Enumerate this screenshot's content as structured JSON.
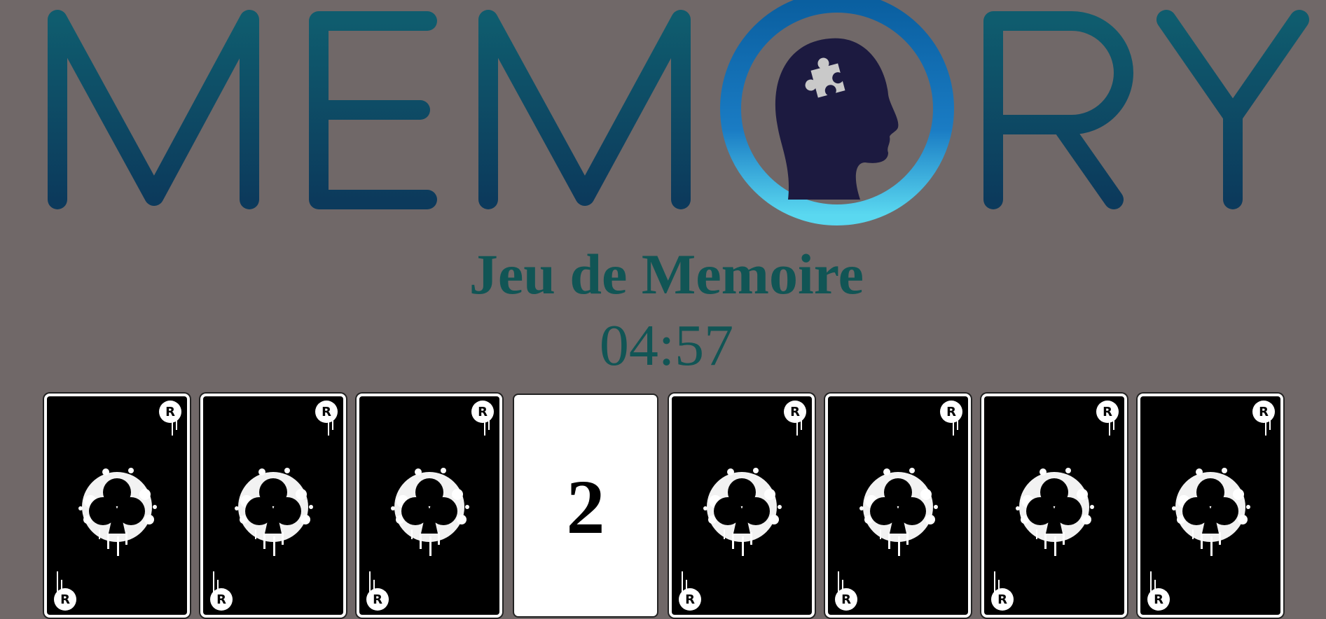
{
  "logo": {
    "text": "MEMORY",
    "colors": {
      "letters": "#0e4f66",
      "ring": "#1275b8",
      "head": "#1c1a40",
      "puzzle": "#c7c7c7"
    },
    "icon": "brain-puzzle-head-icon"
  },
  "game": {
    "title": "Jeu de Memoire",
    "timer": "04:57"
  },
  "cards": [
    {
      "state": "back",
      "icon": "club-splash-icon"
    },
    {
      "state": "back",
      "icon": "club-splash-icon"
    },
    {
      "state": "back",
      "icon": "club-splash-icon"
    },
    {
      "state": "revealed",
      "value": "2"
    },
    {
      "state": "back",
      "icon": "club-splash-icon"
    },
    {
      "state": "back",
      "icon": "club-splash-icon"
    },
    {
      "state": "back",
      "icon": "club-splash-icon"
    },
    {
      "state": "back",
      "icon": "club-splash-icon"
    }
  ]
}
